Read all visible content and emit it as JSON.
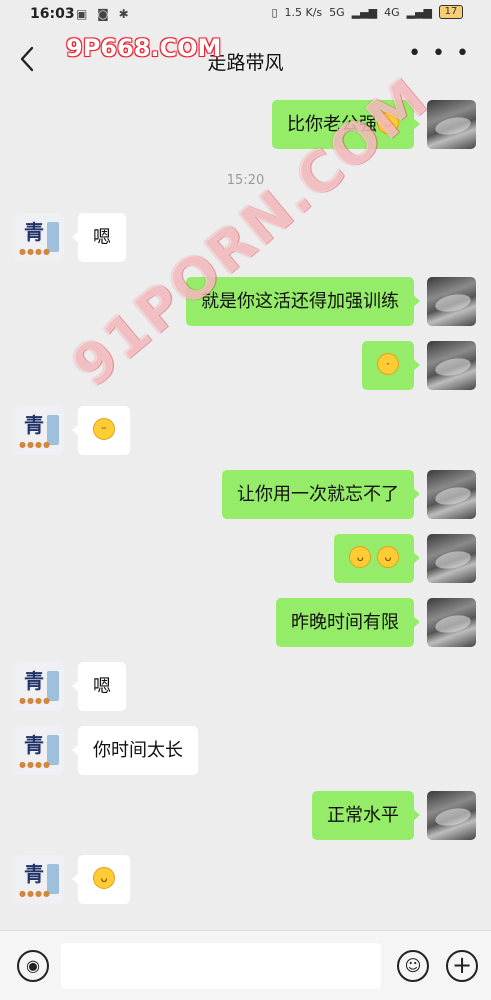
{
  "status_bar": {
    "time": "16:03",
    "network": "1.5 K/s",
    "signal_1": "5G",
    "signal_2": "4G",
    "battery": "17"
  },
  "header": {
    "title": "走路带风"
  },
  "watermarks": {
    "top": "9P668.COM",
    "diagonal": "91PORN.COM"
  },
  "messages": [
    {
      "from": "me",
      "text": "比你老公强",
      "emoji": true
    },
    {
      "type": "time",
      "text": "15:20"
    },
    {
      "from": "them",
      "text": "嗯"
    },
    {
      "from": "me",
      "text": "就是你这活还得加强训练"
    },
    {
      "from": "me",
      "text": "",
      "emoji": true
    },
    {
      "from": "them",
      "text": "",
      "emoji": true
    },
    {
      "from": "me",
      "text": "让你用一次就忘不了"
    },
    {
      "from": "me",
      "text": "",
      "emoji_double": true
    },
    {
      "from": "me",
      "text": "昨晚时间有限"
    },
    {
      "from": "them",
      "text": "嗯"
    },
    {
      "from": "them",
      "text": "你时间太长"
    },
    {
      "from": "me",
      "text": "正常水平"
    },
    {
      "from": "them",
      "text": "",
      "emoji": true
    }
  ],
  "input": {
    "placeholder": ""
  },
  "icons": {
    "back": "back-arrow-icon",
    "more": "more-dots-icon",
    "voice": "voice-icon",
    "emoji": "emoji-icon",
    "plus": "plus-icon"
  }
}
